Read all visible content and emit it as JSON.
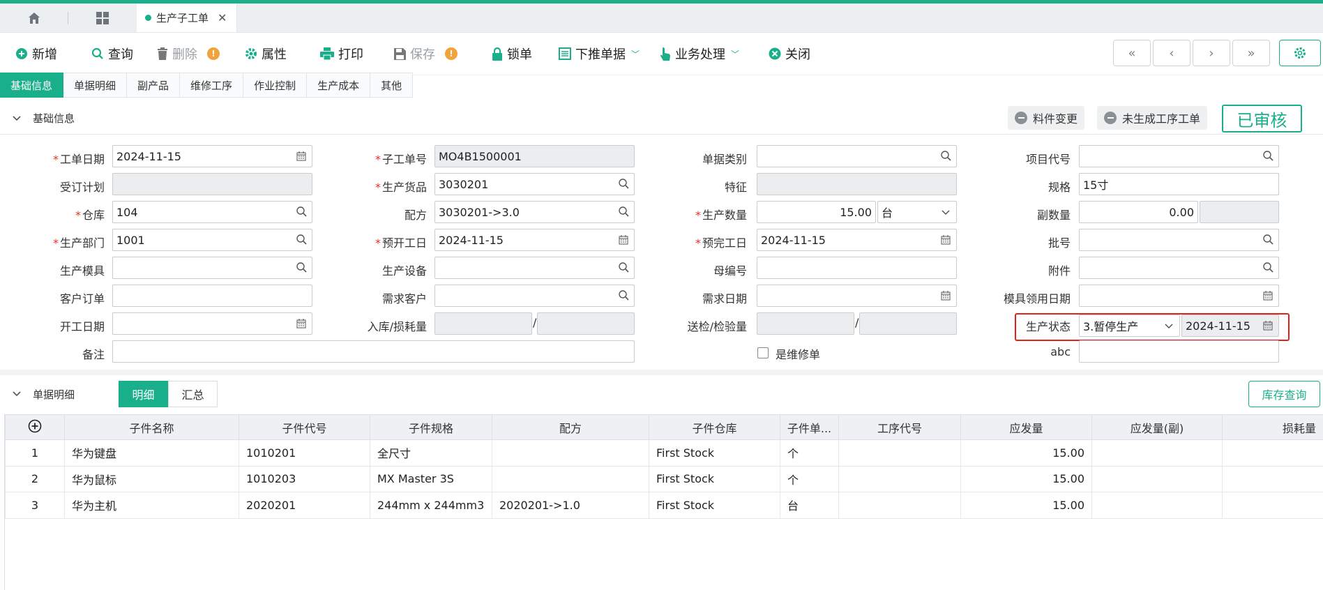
{
  "tabs": {
    "doc_title": "生产子工单"
  },
  "toolbar": {
    "new": "新增",
    "query": "查询",
    "delete": "删除",
    "properties": "属性",
    "print": "打印",
    "save": "保存",
    "lock": "锁单",
    "push_down": "下推单据",
    "business": "业务处理",
    "close": "关闭"
  },
  "subtabs": [
    "基础信息",
    "单据明细",
    "副产品",
    "维修工序",
    "作业控制",
    "生产成本",
    "其他"
  ],
  "section_basic": {
    "title": "基础信息",
    "material_change": "料件变更",
    "no_process_order": "未生成工序工单",
    "status_badge": "已审核"
  },
  "form": {
    "order_date": {
      "label": "工单日期",
      "value": "2024-11-15"
    },
    "sub_order_no": {
      "label": "子工单号",
      "value": "MO4B1500001"
    },
    "doc_type": {
      "label": "单据类别",
      "value": ""
    },
    "project_code": {
      "label": "项目代号",
      "value": ""
    },
    "order_plan": {
      "label": "受订计划",
      "value": ""
    },
    "product": {
      "label": "生产货品",
      "value": "3030201"
    },
    "feature": {
      "label": "特征",
      "value": ""
    },
    "spec": {
      "label": "规格",
      "value": "15寸"
    },
    "warehouse": {
      "label": "仓库",
      "value": "104"
    },
    "formula": {
      "label": "配方",
      "value": "3030201->3.0"
    },
    "qty": {
      "label": "生产数量",
      "value": "15.00",
      "unit": "台"
    },
    "sub_qty": {
      "label": "副数量",
      "value": "0.00"
    },
    "dept": {
      "label": "生产部门",
      "value": "1001"
    },
    "plan_start": {
      "label": "预开工日",
      "value": "2024-11-15"
    },
    "plan_end": {
      "label": "预完工日",
      "value": "2024-11-15"
    },
    "batch": {
      "label": "批号",
      "value": ""
    },
    "mold": {
      "label": "生产模具",
      "value": ""
    },
    "equipment": {
      "label": "生产设备",
      "value": ""
    },
    "parent_no": {
      "label": "母编号",
      "value": ""
    },
    "attachment": {
      "label": "附件",
      "value": ""
    },
    "customer_order": {
      "label": "客户订单",
      "value": ""
    },
    "demand_customer": {
      "label": "需求客户",
      "value": ""
    },
    "demand_date": {
      "label": "需求日期",
      "value": ""
    },
    "mold_date": {
      "label": "模具领用日期",
      "value": ""
    },
    "start_date": {
      "label": "开工日期",
      "value": ""
    },
    "in_loss": {
      "label": "入库/损耗量",
      "value1": "",
      "value2": ""
    },
    "inspect": {
      "label": "送检/检验量",
      "value1": "",
      "value2": ""
    },
    "prod_status": {
      "label": "生产状态",
      "value": "3.暂停生产",
      "date": "2024-11-15"
    },
    "remark": {
      "label": "备注",
      "value": ""
    },
    "repair": {
      "label": "是维修单"
    },
    "abc": {
      "label": "abc",
      "value": ""
    }
  },
  "section_detail": {
    "title": "单据明细",
    "tab_detail": "明细",
    "tab_summary": "汇总",
    "stock_query": "库存查询"
  },
  "table": {
    "headers": [
      "子件名称",
      "子件代号",
      "子件规格",
      "配方",
      "子件仓库",
      "子件单...",
      "工序代号",
      "应发量",
      "应发量(副)",
      "损耗量"
    ],
    "rows": [
      {
        "no": "1",
        "name": "华为键盘",
        "code": "1010201",
        "spec": "全尺寸",
        "formula": "",
        "wh": "First Stock",
        "unit": "个",
        "proc": "",
        "qty": "15.00",
        "qty2": "",
        "loss": ""
      },
      {
        "no": "2",
        "name": "华为鼠标",
        "code": "1010203",
        "spec": "MX Master 3S",
        "formula": "",
        "wh": "First Stock",
        "unit": "个",
        "proc": "",
        "qty": "15.00",
        "qty2": "",
        "loss": ""
      },
      {
        "no": "3",
        "name": "华为主机",
        "code": "2020201",
        "spec": "244mm x 244mm3",
        "formula": "2020201->1.0",
        "wh": "First Stock",
        "unit": "台",
        "proc": "",
        "qty": "15.00",
        "qty2": "",
        "loss": ""
      }
    ]
  }
}
